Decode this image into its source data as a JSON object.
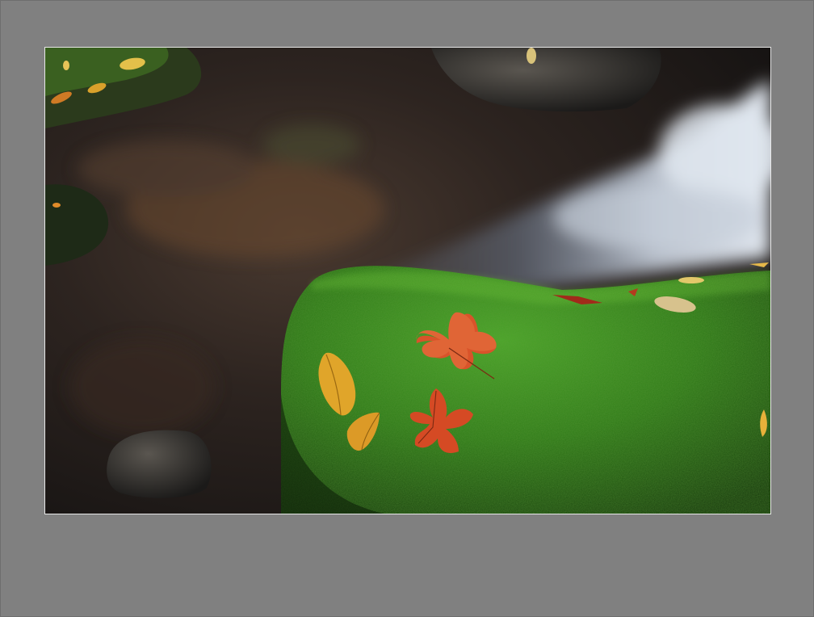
{
  "image": {
    "alt": "",
    "subject_icons": [
      "stream-water",
      "moss-rock",
      "maple-leaf",
      "yellow-leaf"
    ]
  },
  "colors": {
    "background": "#808080",
    "border": "#e8e8e8",
    "moss": "#3f8f22",
    "water": "#c9d3e2",
    "leaf_red": "#d9532a",
    "leaf_yellow": "#e0a52a"
  }
}
